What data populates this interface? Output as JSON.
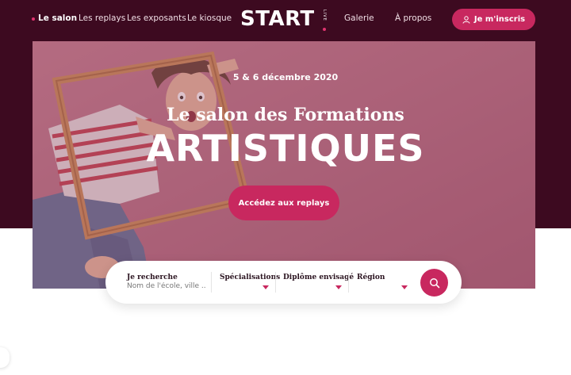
{
  "nav": {
    "items": [
      {
        "label": "Le salon",
        "active": true
      },
      {
        "label": "Les replays",
        "active": false
      },
      {
        "label": "Les exposants",
        "active": false
      },
      {
        "label": "Le kiosque",
        "active": false
      },
      {
        "label": "Galerie",
        "active": false
      },
      {
        "label": "À propos",
        "active": false
      }
    ],
    "logo": {
      "text": "START",
      "sub": "LIVE"
    },
    "signup_label": "Je m'inscris"
  },
  "hero": {
    "date": "5 & 6 décembre 2020",
    "subtitle": "Le salon des Formations",
    "title": "ARTISTIQUES",
    "replay_button": "Accédez aux replays"
  },
  "search": {
    "fields": [
      {
        "label": "Je recherche",
        "placeholder": "Nom de l'école, ville ..."
      },
      {
        "label": "Spécialisations"
      },
      {
        "label": "Diplôme envisagé"
      },
      {
        "label": "Région"
      }
    ]
  },
  "icons": {
    "user": "user-icon",
    "search": "search-icon",
    "dropdown": "chevron-down-icon"
  },
  "colors": {
    "accent": "#c8285f",
    "dark_bg": "#3d0a20",
    "hero_tint": "#b56a80"
  }
}
